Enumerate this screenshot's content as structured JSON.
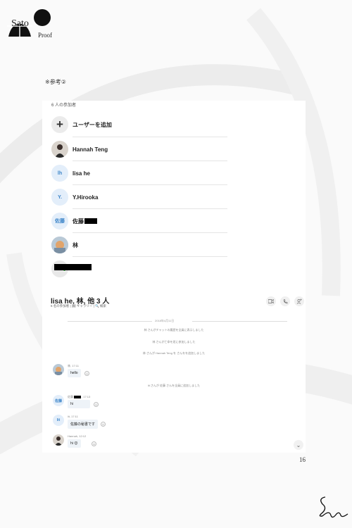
{
  "logo": {
    "line1": "Sato",
    "line2": "Proof"
  },
  "reference_note": "※参考②",
  "participants": {
    "title": "6 人の参加者",
    "add_user_label": "ユーザーを追加",
    "items": [
      {
        "name": "Hannah Teng",
        "avatar_type": "photo"
      },
      {
        "name": "lisa he",
        "avatar_initials": "lh"
      },
      {
        "name": "Y.Hirooka",
        "avatar_initials": "Y."
      },
      {
        "name": "佐藤",
        "avatar_initials": "佐藤",
        "redacted": true
      },
      {
        "name": "林",
        "avatar_type": "photo"
      },
      {
        "name": "",
        "redacted": true,
        "online": true
      }
    ]
  },
  "chat": {
    "title": "lisa he, 林, 他 3 人",
    "subtitle": "6 名の参加者 | 🖼 ギャラリー | 🔍 検索",
    "header_icons": [
      "video-call-icon",
      "phone-icon",
      "add-person-icon"
    ],
    "date_label": "2018年4月11日",
    "system_messages": [
      "林 さんがチャットの履歴を全員に表示しました",
      "林 さんが亡命を班に参加しました",
      "林 さんが Hannah Teng を さんをを追加しました",
      "lit さんが 佐藤 さんを全員に追加しました"
    ],
    "messages": [
      {
        "sender": "林",
        "time": "17:11",
        "text": "hello",
        "avatar_type": "photo"
      },
      {
        "sender": "佐藤",
        "time": "17:13",
        "text": "hi",
        "avatar_initials": "佐藤"
      },
      {
        "sender": "lit",
        "time": "17:11",
        "text": "佐藤の秘書です",
        "avatar_initials": "lit"
      },
      {
        "sender": "Hannah",
        "time": "12:12",
        "text": "hi 😊",
        "avatar_type": "photo"
      }
    ]
  },
  "page_number": "16"
}
